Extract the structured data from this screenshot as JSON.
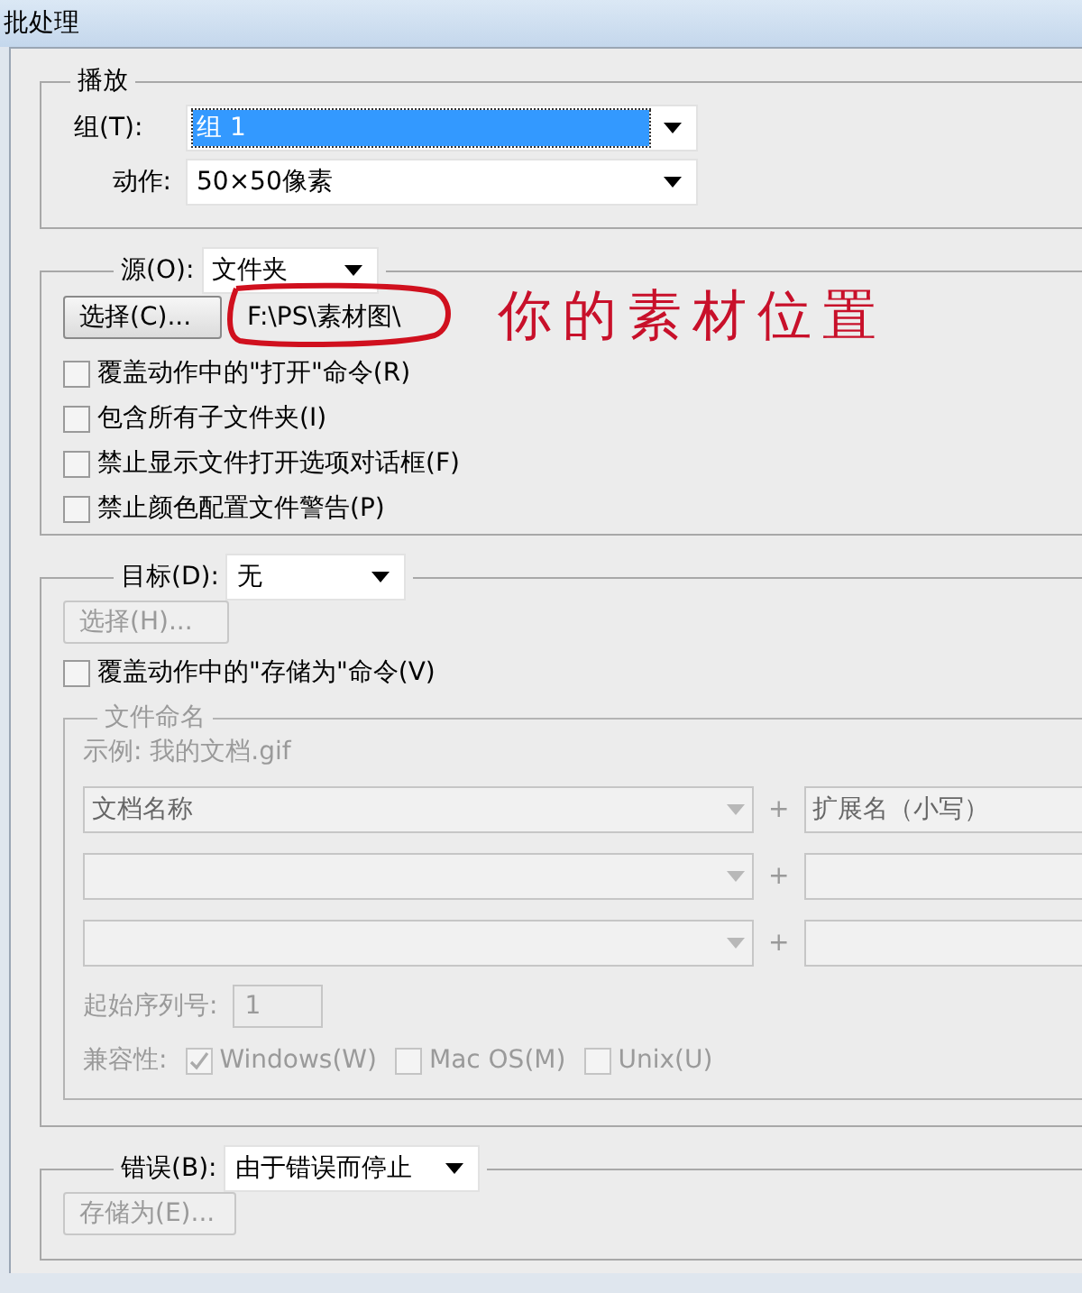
{
  "window": {
    "title": "批处理"
  },
  "play": {
    "legend": "播放",
    "group": {
      "label": "组(T):",
      "value": "组 1",
      "highlighted": true
    },
    "action": {
      "label": "动作:",
      "value": "50×50像素",
      "highlighted": false
    }
  },
  "source": {
    "label": "源(O):",
    "value": "文件夹",
    "choose_button": "选择(C)...",
    "path": "F:\\PS\\素材图\\",
    "annotation": "你的素材位置",
    "options": [
      {
        "label": "覆盖动作中的\"打开\"命令(R)",
        "checked": false
      },
      {
        "label": "包含所有子文件夹(I)",
        "checked": false
      },
      {
        "label": "禁止显示文件打开选项对话框(F)",
        "checked": false
      },
      {
        "label": "禁止颜色配置文件警告(P)",
        "checked": false
      }
    ]
  },
  "destination": {
    "label": "目标(D):",
    "value": "无",
    "choose_button": {
      "label": "选择(H)...",
      "disabled": true
    },
    "override_save": {
      "label": "覆盖动作中的\"存储为\"命令(V)",
      "checked": false
    },
    "file_naming": {
      "legend": "文件命名",
      "disabled": true,
      "example": "示例: 我的文档.gif",
      "rows": [
        {
          "name": "文档名称",
          "separator": "+",
          "extension": "扩展名（小写）"
        },
        {
          "separator": "+"
        },
        {
          "separator": "+"
        }
      ],
      "start_serial": {
        "label": "起始序列号:",
        "value": "1"
      },
      "compatibility": {
        "label": "兼容性:",
        "options": [
          {
            "label": "Windows(W)",
            "checked": true
          },
          {
            "label": "Mac OS(M)",
            "checked": false
          },
          {
            "label": "Unix(U)",
            "checked": false
          }
        ]
      }
    }
  },
  "errors": {
    "label": "错误(B):",
    "value": "由于错误而停止",
    "save_button": {
      "label": "存储为(E)...",
      "disabled": true
    }
  }
}
